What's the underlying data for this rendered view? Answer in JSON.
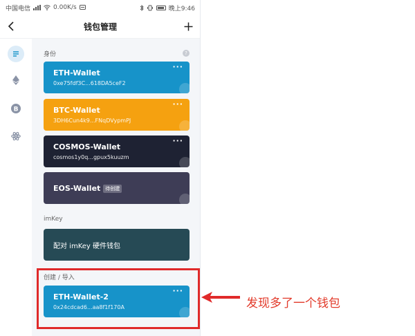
{
  "status_bar": {
    "carrier": "中国电信",
    "speed": "0.00K/s",
    "time": "晚上9:46",
    "icons": [
      "signal-icon",
      "wifi-icon",
      "message-icon",
      "bluetooth-icon",
      "vibrate-icon",
      "battery-icon"
    ]
  },
  "nav": {
    "title": "钱包管理",
    "back_icon": "chevron-left-icon",
    "add_icon": "plus-icon"
  },
  "sidebar": {
    "items": [
      {
        "name": "identity-icon",
        "active": true
      },
      {
        "name": "ethereum-icon",
        "active": false
      },
      {
        "name": "bitcoin-icon",
        "active": false
      },
      {
        "name": "cosmos-icon",
        "active": false
      }
    ]
  },
  "sections": {
    "identity": "身份",
    "imkey": "imKey",
    "create_import": "创建 / 导入",
    "help_icon": "help-icon"
  },
  "wallets": [
    {
      "name": "ETH-Wallet",
      "address": "0xe75fdf3C...618DA5ceF2",
      "color": "#1793c9"
    },
    {
      "name": "BTC-Wallet",
      "address": "3DH6Cun4k9...FNqDVypmPJ",
      "color": "#f5a110"
    },
    {
      "name": "COSMOS-Wallet",
      "address": "cosmos1y0q...gpux5kuuzm",
      "color": "#1e2233"
    },
    {
      "name": "EOS-Wallet",
      "badge": "待创建",
      "color": "#3e3d56"
    }
  ],
  "imkey_button": "配对 imKey 硬件钱包",
  "new_wallet": {
    "name": "ETH-Wallet-2",
    "address": "0x24cdcad6...aa8f1f170A",
    "color": "#1793c9"
  },
  "more_label": "···",
  "annotation": {
    "text": "发现多了一个钱包",
    "color": "#e02a2a"
  }
}
